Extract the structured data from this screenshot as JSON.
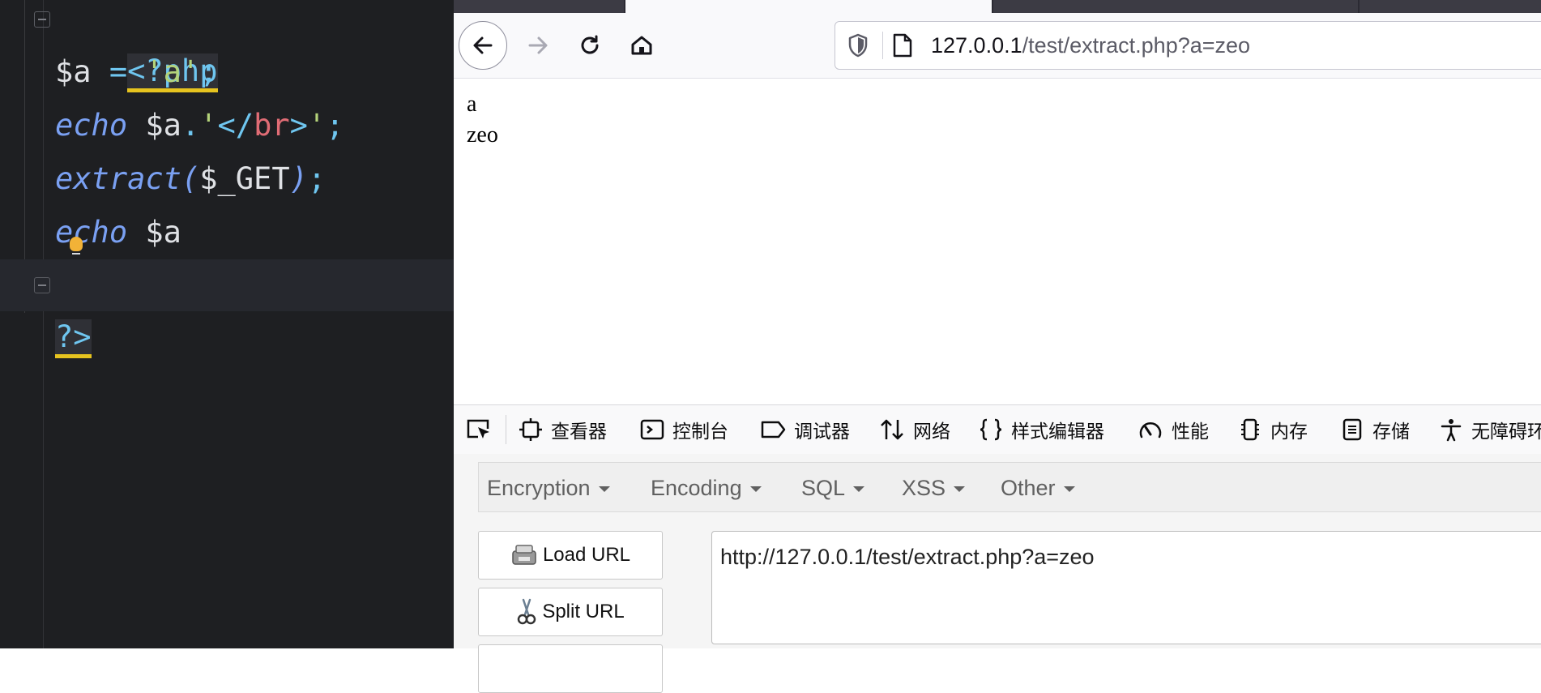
{
  "editor": {
    "lines": {
      "l1": {
        "open_tag": "<?php"
      },
      "l2": {
        "var": "$a",
        "op": " = ",
        "str": "'a'",
        "end": ";"
      },
      "l3": {
        "kw": "echo",
        "var": " $a",
        "dot": ".",
        "q1": "'",
        "tag_open": "</",
        "tag_name": "br",
        "tag_close": ">",
        "q2": "'",
        "end": ";"
      },
      "l4": {
        "kw": "extract",
        "paren_open": "(",
        "arg": "$_GET",
        "paren_close": ")",
        "end": ";"
      },
      "l5": {
        "kw": "echo",
        "var": " $a"
      },
      "l6": {
        "close_tag": "?>"
      }
    }
  },
  "browser": {
    "nav": {
      "back_icon": "arrow-left-icon",
      "forward_icon": "arrow-right-icon",
      "reload_icon": "reload-icon",
      "home_icon": "home-icon"
    },
    "url": {
      "host": "127.0.0.1",
      "path": "/test/extract.php?a=zeo"
    },
    "page": {
      "line1": "a",
      "line2": "zeo"
    }
  },
  "devtools": {
    "tabs": [
      {
        "label": "查看器",
        "icon": "inspector-icon"
      },
      {
        "label": "控制台",
        "icon": "console-icon"
      },
      {
        "label": "调试器",
        "icon": "debugger-icon"
      },
      {
        "label": "网络",
        "icon": "network-icon"
      },
      {
        "label": "样式编辑器",
        "icon": "style-editor-icon"
      },
      {
        "label": "性能",
        "icon": "performance-icon"
      },
      {
        "label": "内存",
        "icon": "memory-icon"
      },
      {
        "label": "存储",
        "icon": "storage-icon"
      },
      {
        "label": "无障碍环",
        "icon": "accessibility-icon"
      }
    ]
  },
  "hackbar": {
    "menu": [
      "Encryption",
      "Encoding",
      "SQL",
      "XSS",
      "Other"
    ],
    "load_url": "Load URL",
    "split_url": "Split URL",
    "url_value": "http://127.0.0.1/test/extract.php?a=zeo"
  },
  "colors": {
    "editor_bg": "#1e1f22",
    "php_tag": "#6fc6f0",
    "keyword": "#7aa0f2",
    "string": "#b4d37a",
    "html_tag": "#e06c75",
    "tag_highlight": "#e6c31f"
  }
}
